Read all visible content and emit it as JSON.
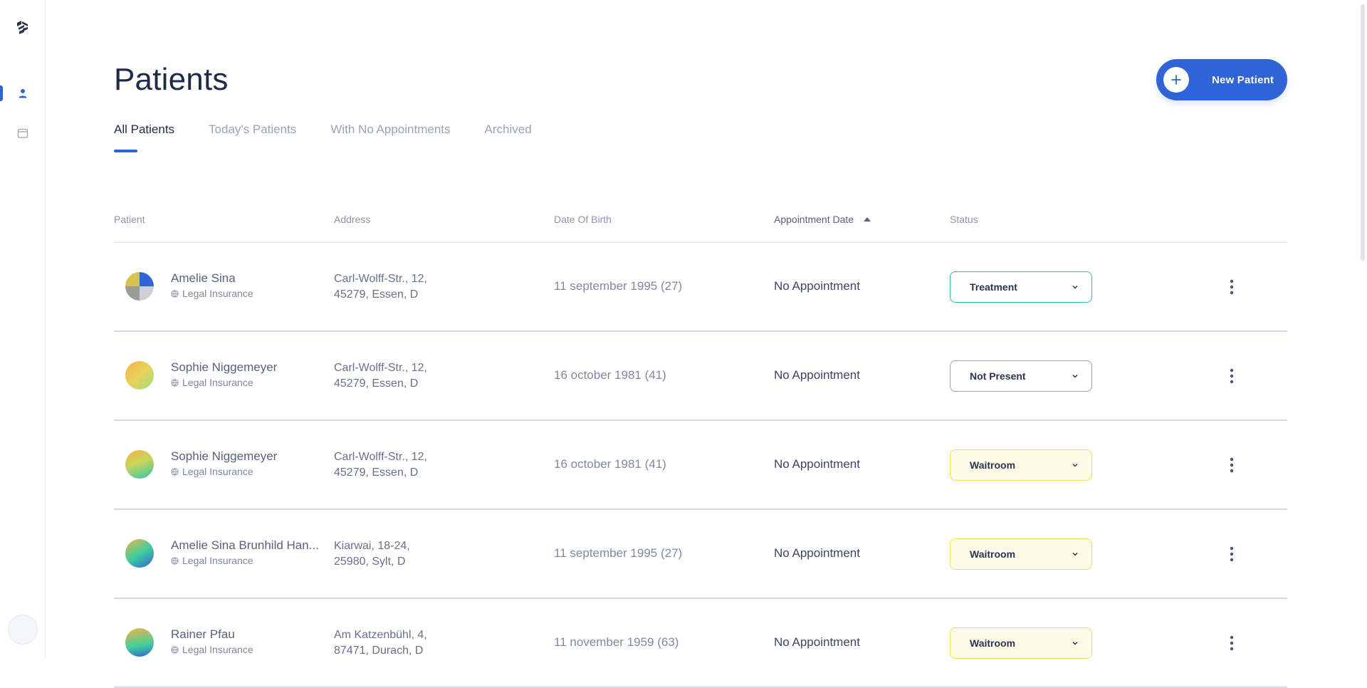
{
  "page": {
    "title": "Patients"
  },
  "actions": {
    "new_patient_label": "New Patient"
  },
  "tabs": [
    {
      "label": "All Patients",
      "active": true
    },
    {
      "label": "Today's Patients",
      "active": false
    },
    {
      "label": "With No Appointments",
      "active": false
    },
    {
      "label": "Archived",
      "active": false
    }
  ],
  "table": {
    "columns": [
      "Patient",
      "Address",
      "Date Of Birth",
      "Appointment Date",
      "Status"
    ],
    "sorted_column": "Appointment Date",
    "rows": [
      {
        "name": "Amelie Sina",
        "insurance": "Legal Insurance",
        "address_line1": "Carl-Wolff-Str., 12,",
        "address_line2": "45279, Essen, D",
        "dob": "11 september 1995 (27)",
        "appointment": "No Appointment",
        "status": "Treatment"
      },
      {
        "name": "Sophie Niggemeyer",
        "insurance": "Legal Insurance",
        "address_line1": "Carl-Wolff-Str., 12,",
        "address_line2": "45279, Essen, D",
        "dob": "16 october 1981 (41)",
        "appointment": "No Appointment",
        "status": "Not Present"
      },
      {
        "name": "Sophie Niggemeyer",
        "insurance": "Legal Insurance",
        "address_line1": "Carl-Wolff-Str., 12,",
        "address_line2": "45279, Essen, D",
        "dob": "16 october 1981 (41)",
        "appointment": "No Appointment",
        "status": "Waitroom"
      },
      {
        "name": "Amelie Sina Brunhild Han...",
        "insurance": "Legal Insurance",
        "address_line1": "Kiarwai, 18-24,",
        "address_line2": "25980, Sylt, D",
        "dob": "11 september 1995 (27)",
        "appointment": "No Appointment",
        "status": "Waitroom"
      },
      {
        "name": "Rainer Pfau",
        "insurance": "Legal Insurance",
        "address_line1": "Am Katzenbühl, 4,",
        "address_line2": "87471, Durach, D",
        "dob": "11 november 1959 (63)",
        "appointment": "No Appointment",
        "status": "Waitroom"
      }
    ]
  },
  "colors": {
    "primary": "#2f63d6",
    "status_treatment": "#26c3a0",
    "status_not_present": "#9aa3b5",
    "status_waitroom": "#f2dd57"
  },
  "icons": {
    "logo": "clinic-logo-icon",
    "nav": [
      "user-icon",
      "calendar-icon"
    ],
    "insurance": "globe-icon",
    "status": "chevron-down-icon",
    "row_menu": "more-vertical-icon",
    "add": "plus-icon"
  }
}
